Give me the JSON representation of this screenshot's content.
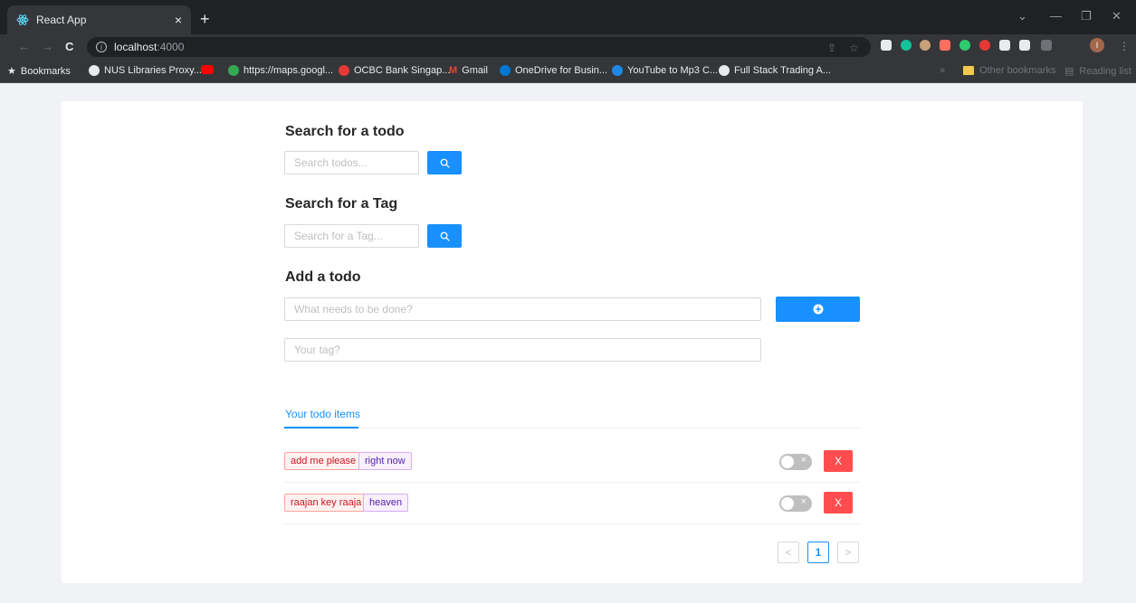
{
  "browser": {
    "tab_title": "React App",
    "tab_close": "×",
    "new_tab": "+",
    "url_host": "localhost",
    "url_port": ":4000",
    "bookmarks": [
      {
        "label": "Bookmarks",
        "color": "#e8eaed"
      },
      {
        "label": "NUS Libraries Proxy...",
        "color": "#e8eaed"
      },
      {
        "label": "",
        "color": "#ff0000"
      },
      {
        "label": "https://maps.googl...",
        "color": "#34a853"
      },
      {
        "label": "OCBC Bank Singap...",
        "color": "#e53935"
      },
      {
        "label": "Gmail",
        "color": "#ea4335"
      },
      {
        "label": "OneDrive for Busin...",
        "color": "#0078d4"
      },
      {
        "label": "YouTube to Mp3 C...",
        "color": "#1e88e5"
      },
      {
        "label": "Full Stack Trading A...",
        "color": "#e8eaed"
      }
    ],
    "bookmarks_overflow": "»",
    "other_bookmarks": "Other bookmarks",
    "reading_list": "Reading list",
    "profile_initial": "I"
  },
  "search_todo": {
    "heading": "Search for a todo",
    "placeholder": "Search todos..."
  },
  "search_tag": {
    "heading": "Search for a Tag",
    "placeholder": "Search for a Tag..."
  },
  "add_todo": {
    "heading": "Add a todo",
    "todo_placeholder": "What needs to be done?",
    "tag_placeholder": "Your tag?"
  },
  "tabs": {
    "active_label": "Your todo items"
  },
  "todos": [
    {
      "tags": [
        {
          "text": "add me please",
          "color": "red"
        },
        {
          "text": "right now",
          "color": "purple"
        }
      ],
      "completed": false,
      "delete_label": "X",
      "switch_off": "×"
    },
    {
      "tags": [
        {
          "text": "raajan key raaja",
          "color": "red"
        },
        {
          "text": "heaven",
          "color": "purple"
        }
      ],
      "completed": false,
      "delete_label": "X",
      "switch_off": "×"
    }
  ],
  "pagination": {
    "prev": "<",
    "current": "1",
    "next": ">"
  },
  "colors": {
    "primary": "#1890ff",
    "danger": "#ff4d4f"
  }
}
